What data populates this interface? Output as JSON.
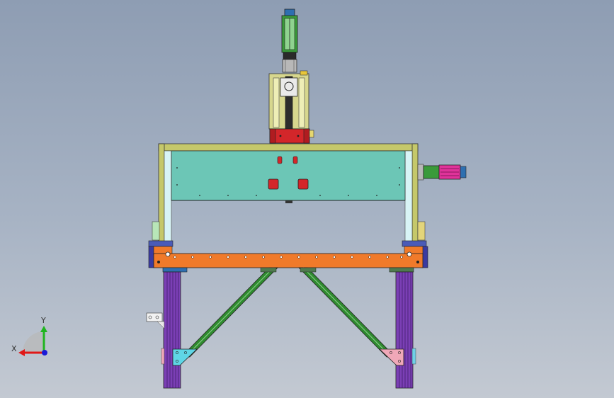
{
  "viewport": {
    "view": "front",
    "background_top": "#8e9db3",
    "background_bottom": "#c3c9d2"
  },
  "colors": {
    "frame_olive": "#c5c86a",
    "panel_teal": "#6cc6b6",
    "beam_orange": "#f07a2a",
    "leg_purple": "#7b3fb5",
    "brace_green": "#2f8a2f",
    "block_red": "#d3262a",
    "motor_magenta": "#e0339a",
    "gusset_cyan": "#5fd6e6",
    "gusset_pink": "#f0a8b8"
  },
  "triad": {
    "x_label": "X",
    "y_label": "Y",
    "x_color": "#e01818",
    "y_color": "#1fb51f",
    "z_color": "#1a1ad6"
  }
}
